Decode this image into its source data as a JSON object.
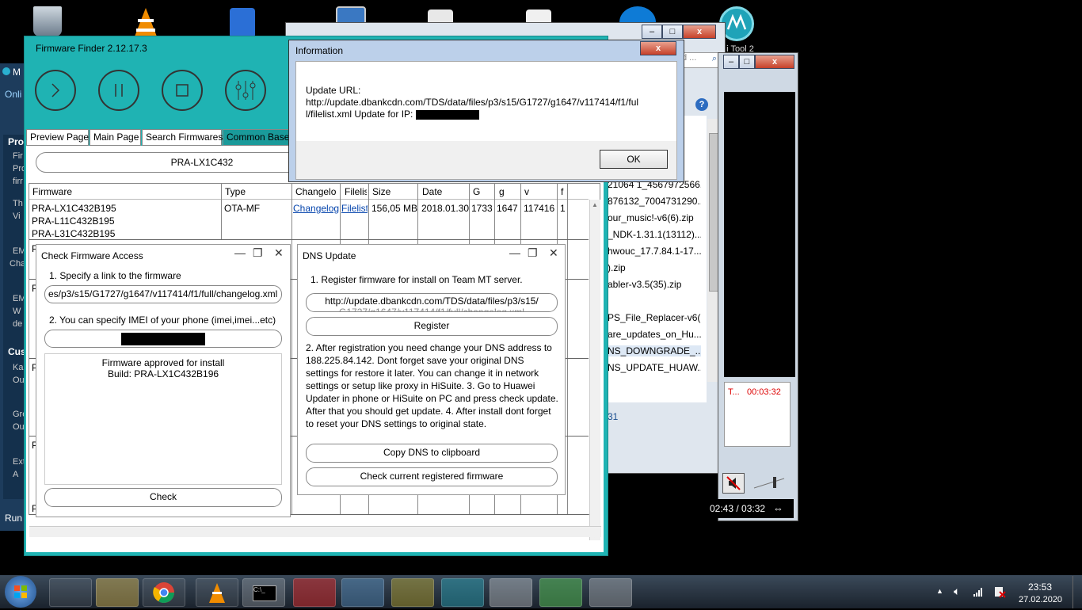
{
  "desktop": {
    "icons": [
      "recycle-bin-icon",
      "vlc-icon",
      "document-icon",
      "computer-icon",
      "file-icon",
      "file-icon-2",
      "teamviewer-icon",
      "mt-tool-icon"
    ],
    "mt_tool_label": "...i Tool 2"
  },
  "firmware_finder": {
    "title": "Firmware Finder 2.12.17.3",
    "tabs": [
      "Preview Page",
      "Main Page",
      "Search Firmwares",
      "Common Base"
    ],
    "model": "PRA-LX1C432",
    "grid": {
      "columns": [
        "Firmware",
        "Type",
        "Changelo",
        "Filelis",
        "Size",
        "Date",
        "G",
        "g",
        "v",
        "f"
      ],
      "row": {
        "firmwares": [
          "PRA-LX1C432B195",
          "PRA-L11C432B195",
          "PRA-L31C432B195"
        ],
        "type": "OTA-MF",
        "changelog": "Changelog",
        "filelist": "Filelist",
        "size": "156,05 MB",
        "date": "2018.01.30",
        "g1": "1733",
        "g2": "1647",
        "v": "117416",
        "f": "1"
      },
      "row_prefix": "P"
    }
  },
  "left_app": {
    "title_fragment": "M",
    "online_fragment": "Onli",
    "items": [
      "Pro",
      "Fir",
      "Pro",
      "firr",
      "Th",
      "Vi",
      "EM",
      "Cha",
      "EM",
      "W",
      "de",
      "Cus",
      "Ka",
      "Ou",
      "Gre",
      "Ou",
      "Ext",
      "A"
    ],
    "run_label": "Run"
  },
  "info_dialog": {
    "title": "Information",
    "line1": "Update URL:",
    "line2": "http://update.dbankcdn.com/TDS/data/files/p3/s15/G1727/g1647/v117414/f1/ful",
    "line3": "l/filelist.xml Update for IP:",
    "ok": "OK",
    "close": "x"
  },
  "check_access": {
    "title": "Check Firmware Access",
    "step1": "1. Specify a link to the firmware",
    "link_value": "es/p3/s15/G1727/g1647/v117414/f1/full/changelog.xml",
    "step2": "2. You can specify IMEI of your phone (imei,imei...etc)",
    "result_line1": "Firmware approved for install",
    "result_line2": "Build: PRA-LX1C432B196",
    "check": "Check"
  },
  "dns_update": {
    "title": "DNS Update",
    "step1": "1. Register firmware for install on Team MT server.",
    "url_value": "http://update.dbankcdn.com/TDS/data/files/p3/s15/",
    "url_value_2": "G1727/g1647/v117414/f1/full/changelog.xml",
    "register": "Register",
    "step2": "2. After registration you need change your DNS address to 188.225.84.142. Dont forget save your original DNS settings for restore it later. You can change it in network settings or setup like proxy in HiSuite. 3. Go to Huawei Updater in phone or HiSuite on PC and press check update. After that you should get update. 4. After install dont forget to reset your DNS settings to original state.",
    "copy": "Copy DNS to clipboard",
    "check_registered": "Check current registered firmware"
  },
  "explorer": {
    "search_placeholder": "d ...",
    "files": [
      "21064 1_4567972566...",
      "876132_7004731290...",
      "our_music!-v6(6).zip",
      "_NDK-1.31.1(13112)...",
      "hwouc_17.7.84.1-17...",
      ").zip",
      "abler-v3.5(35).zip",
      "",
      "PS_File_Replacer-v6(...",
      "are_updates_on_Hu...",
      "NS_DOWNGRADE_...",
      "NS_UPDATE_HUAW..."
    ],
    "status_fragment": "31"
  },
  "media_player": {
    "timer_label": "T...",
    "timer": "00:03:32",
    "position": "02:43 / 03:32"
  },
  "taskbar": {
    "items": [
      "ie-icon",
      "explorer-icon",
      "chrome-icon",
      "vlc-icon",
      "cmd-icon",
      "toolbox-icon",
      "control-panel-icon",
      "app-icon",
      "mt-tool-icon",
      "search-tool-icon",
      "media-icon",
      "paint-icon"
    ],
    "time": "23:53",
    "date": "27.02.2020"
  }
}
